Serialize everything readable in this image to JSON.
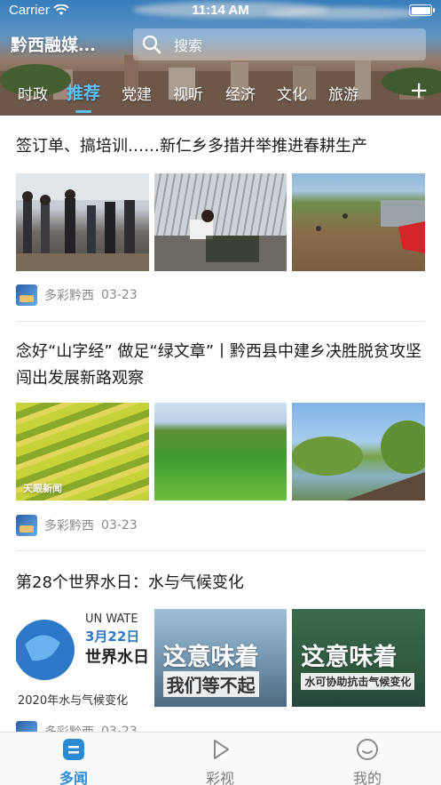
{
  "status_bar": {
    "carrier": "Carrier",
    "time": "11:14 AM"
  },
  "app": {
    "title": "黔西融媒..."
  },
  "search": {
    "placeholder": "搜索"
  },
  "tabs": [
    {
      "label": "时政"
    },
    {
      "label": "推荐"
    },
    {
      "label": "党建"
    },
    {
      "label": "视听"
    },
    {
      "label": "经济"
    },
    {
      "label": "文化"
    },
    {
      "label": "旅游"
    }
  ],
  "tabs_add": "+",
  "articles": [
    {
      "title": "签订单、搞培训……新仁乡多措并举推进春耕生产",
      "source": "多彩黔西",
      "date": "03-23"
    },
    {
      "title": "念好“山字经” 做足“绿文章”丨黔西县中建乡决胜脱贫攻坚闯出发展新路观察",
      "source": "多彩黔西",
      "date": "03-23",
      "image_caption": "天眼新闻"
    },
    {
      "title": "第28个世界水日：水与气候变化",
      "source": "多彩黔西",
      "date": "03-23",
      "image1": {
        "line1": "UN WATE",
        "line2": "3月22日",
        "line3": "世界水日",
        "line4": "2020年水与气候变化"
      },
      "image2": {
        "big": "这意味着",
        "sub": "我们等不起"
      },
      "image3": {
        "big": "这意味着",
        "sub": "水可协助抗击气候变化"
      }
    }
  ],
  "bottom_nav": [
    {
      "label": "多闻",
      "icon": "news-icon"
    },
    {
      "label": "彩视",
      "icon": "play-icon"
    },
    {
      "label": "我的",
      "icon": "smile-icon"
    }
  ],
  "colors": {
    "accent": "#2b8ad6",
    "tab_active": "#5cc2ff"
  }
}
